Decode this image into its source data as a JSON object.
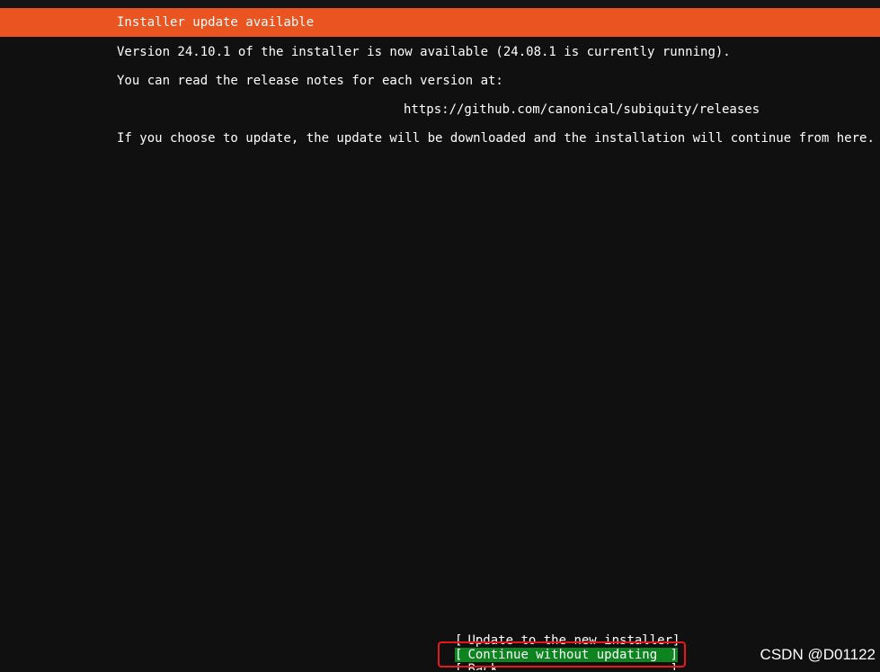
{
  "header": {
    "title": "Installer update available"
  },
  "body": {
    "line1": "Version 24.10.1 of the installer is now available (24.08.1 is currently running).",
    "line2": "You can read the release notes for each version at:",
    "url": "https://github.com/canonical/subiquity/releases",
    "line3": "If you choose to update, the update will be downloaded and the installation will continue from here."
  },
  "menu": {
    "items": [
      {
        "label": "Update to the new installer",
        "selected": false
      },
      {
        "label": "Continue without updating",
        "selected": true
      },
      {
        "label": "Back",
        "selected": false
      }
    ],
    "open_bracket": "[",
    "close_bracket": "]"
  },
  "watermark": "CSDN @D01122",
  "colors": {
    "header_bg": "#e95420",
    "selected_bg": "#0e8420",
    "highlight_border": "#e8161d",
    "background": "#101010"
  }
}
